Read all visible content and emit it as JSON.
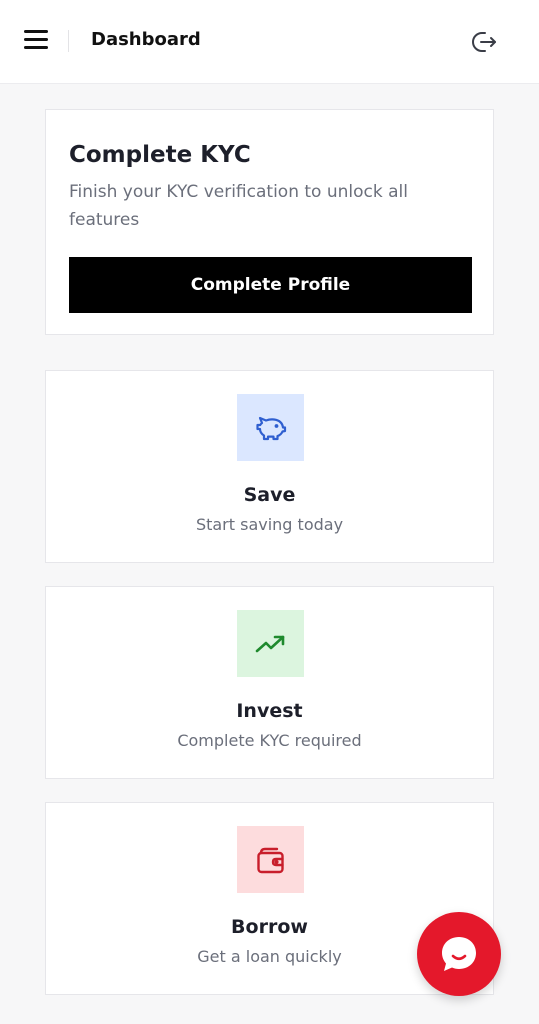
{
  "header": {
    "title": "Dashboard",
    "menu_icon": "hamburger-menu-icon",
    "logout_icon": "logout-icon"
  },
  "kyc_card": {
    "title": "Complete KYC",
    "description": "Finish your KYC verification to unlock all features",
    "button_label": "Complete Profile"
  },
  "features": {
    "save": {
      "title": "Save",
      "subtitle": "Start saving today",
      "icon": "piggy-bank-icon",
      "icon_color": "#2f5fd0",
      "icon_bg": "#dbe7ff"
    },
    "invest": {
      "title": "Invest",
      "subtitle": "Complete KYC required",
      "icon": "trending-up-icon",
      "icon_color": "#1f8a2e",
      "icon_bg": "#dcf5df"
    },
    "borrow": {
      "title": "Borrow",
      "subtitle": "Get a loan quickly",
      "icon": "wallet-icon",
      "icon_color": "#c81e2b",
      "icon_bg": "#fddcdd"
    }
  },
  "chat_button": {
    "icon": "chat-bubble-icon",
    "color": "#e4182b"
  }
}
